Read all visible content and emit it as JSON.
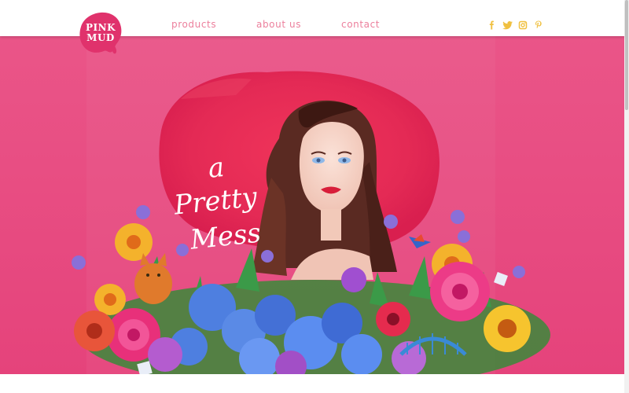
{
  "brand": {
    "line1": "PINK",
    "line2": "MUD"
  },
  "nav": {
    "items": [
      {
        "label": "products"
      },
      {
        "label": "about us"
      },
      {
        "label": "contact"
      }
    ]
  },
  "social": [
    "facebook-icon",
    "twitter-icon",
    "instagram-icon",
    "pinterest-icon"
  ],
  "hero": {
    "tagline": [
      "a",
      "Pretty",
      "Mess"
    ]
  },
  "colors": {
    "hero_bg": "#e84a80",
    "nav_text": "#ec7f9c",
    "social": "#f0c040",
    "logo": "#e0326c"
  }
}
